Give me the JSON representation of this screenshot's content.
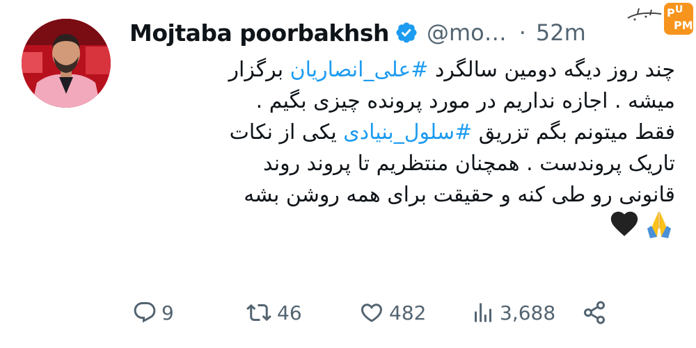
{
  "tweet": {
    "author": {
      "display_name": "Mojtaba poorbakhsh",
      "handle": "@mo…",
      "separator": "·",
      "time": "52m",
      "verified": true
    },
    "lines": [
      [
        {
          "text": "چند روز دیگه دومین سالگرد "
        },
        {
          "text": "#علی_انصاریان",
          "hashtag": true
        },
        {
          "text": " برگزار"
        }
      ],
      [
        {
          "text": "میشه . اجازه نداریم در مورد پرونده چیزی بگیم ."
        }
      ],
      [
        {
          "text": "فقط میتونم بگم تزریق "
        },
        {
          "text": "#سلول_بنیادی",
          "hashtag": true
        },
        {
          "text": " یکی از نکات"
        }
      ],
      [
        {
          "text": "تاریک پروندست  . همچنان منتظریم تا پروند روند"
        }
      ],
      [
        {
          "text": "قانونی رو طی کنه و حقیقت برای همه روشن بشه"
        }
      ]
    ],
    "emojis": [
      "folded-hands",
      "black-heart"
    ],
    "metrics": {
      "replies": "9",
      "retweets": "46",
      "likes": "482",
      "views": "3,688"
    }
  },
  "watermark": {
    "text": "بی‌ام‌پی",
    "logo": "PMP"
  },
  "colors": {
    "text": "#0f1419",
    "secondary": "#536471",
    "link": "#1d9bf0",
    "verified": "#1d9bf0",
    "watermark_orange": "#f7941d"
  }
}
